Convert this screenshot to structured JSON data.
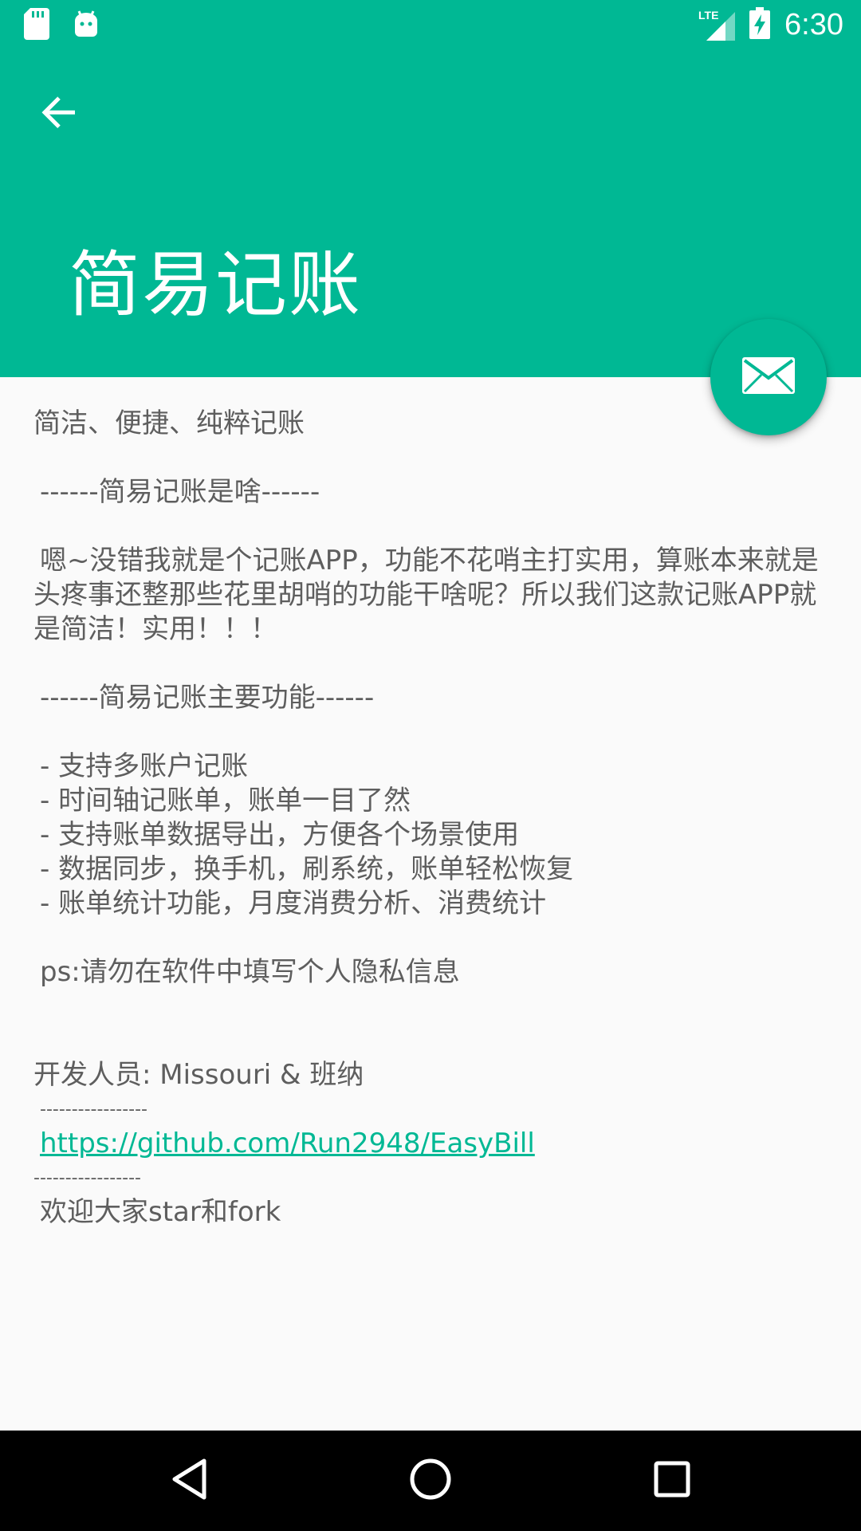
{
  "status_bar": {
    "time": "6:30",
    "network_label": "LTE",
    "icons": [
      "sd-card-icon",
      "android-icon",
      "lte-signal-icon",
      "battery-charging-icon"
    ]
  },
  "app_bar": {
    "back_icon": "arrow-back-icon",
    "title": "简易记账",
    "background_color": "#00b894"
  },
  "fab": {
    "icon": "mail-icon",
    "color": "#00b894"
  },
  "about": {
    "tagline": "简洁、便捷、纯粹记账",
    "section1_heading": "------简易记账是啥------",
    "intro": "嗯~没错我就是个记账APP，功能不花哨主打实用，算账本来就是头疼事还整那些花里胡哨的功能干啥呢？所以我们这款记账APP就是简洁！实用！！！",
    "section2_heading": "------简易记账主要功能------",
    "features": [
      "- 支持多账户记账",
      "- 时间轴记账单，账单一目了然",
      "- 支持账单数据导出，方便各个场景使用",
      "- 数据同步，换手机，刷系统，账单轻松恢复",
      "- 账单统计功能，月度消费分析、消费统计"
    ],
    "ps": "ps:请勿在软件中填写个人隐私信息",
    "developers": "开发人员: Missouri & 班纳",
    "separator1": "-----------------",
    "repo_link": "https://github.com/Run2948/EasyBill",
    "separator2": "-----------------",
    "welcome": "欢迎大家star和fork",
    "link_color": "#00b894"
  },
  "nav_bar": {
    "back_icon": "nav-back-icon",
    "home_icon": "nav-home-icon",
    "recents_icon": "nav-recents-icon"
  }
}
